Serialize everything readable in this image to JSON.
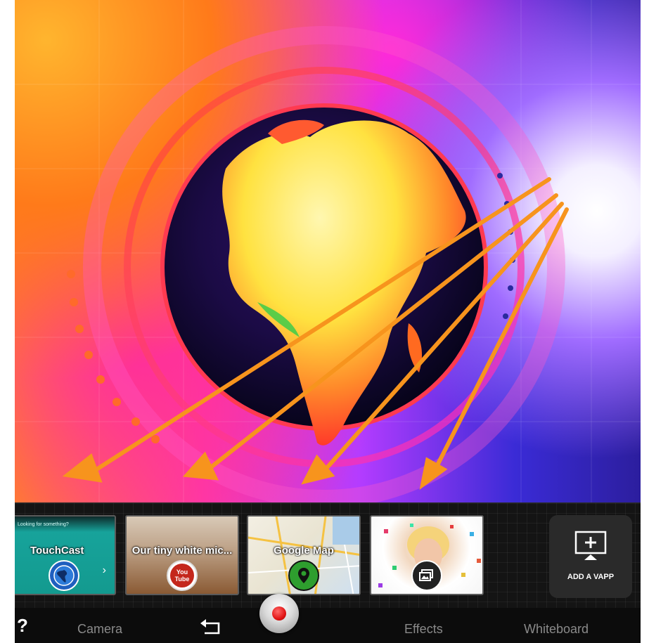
{
  "vapps": [
    {
      "title": "TouchCast",
      "small_text": "Looking for something?",
      "icon": "globe-icon",
      "accent": "#17a39b"
    },
    {
      "title": "Our tiny white mic...",
      "icon": "youtube-icon",
      "badge_text": "You Tube",
      "accent": "#c4271c"
    },
    {
      "title": "Google Map",
      "icon": "map-pin-icon",
      "accent": "#2e9e2e"
    },
    {
      "title": "",
      "icon": "image-gallery-icon",
      "accent": "#222222"
    }
  ],
  "add_vapp": {
    "label": "ADD A VAPP",
    "icon": "add-screen-icon"
  },
  "bottom_bar": {
    "help": "?",
    "camera": "Camera",
    "undo_icon": "undo-icon",
    "record_icon": "record-icon",
    "effects": "Effects",
    "whiteboard": "Whiteboard"
  },
  "colors": {
    "arrow": "#f7941d",
    "record_red": "#e21515"
  }
}
